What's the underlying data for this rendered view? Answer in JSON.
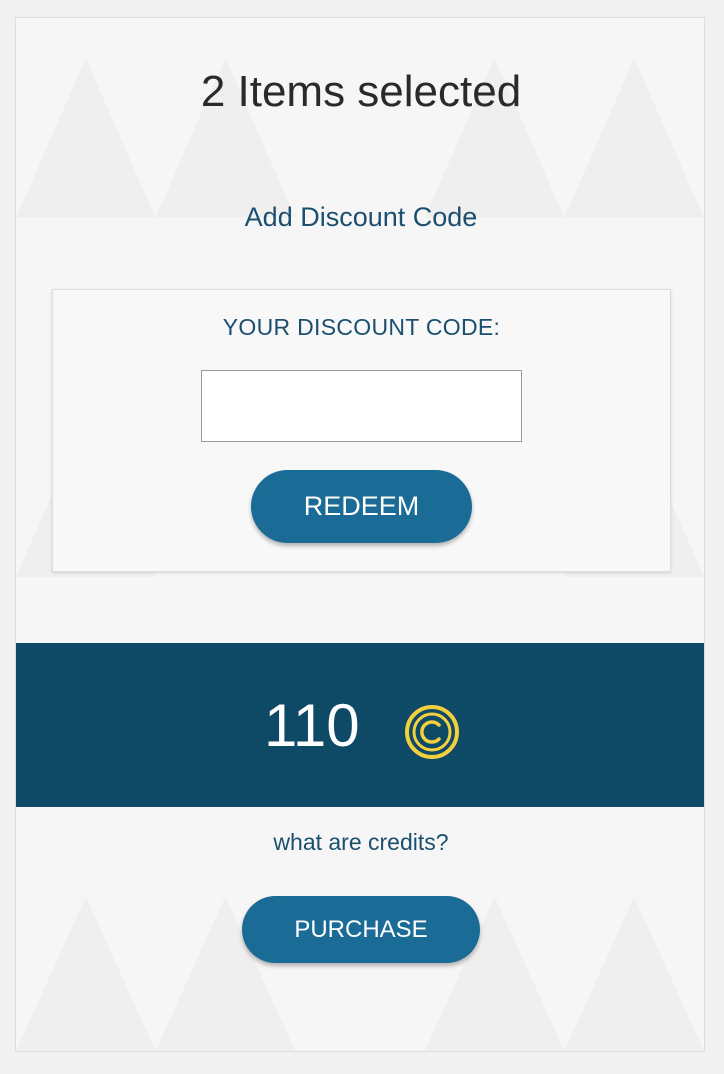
{
  "header": {
    "title": "2 Items selected"
  },
  "discount": {
    "link_label": "Add Discount Code",
    "field_label": "YOUR DISCOUNT CODE:",
    "input_value": "",
    "input_placeholder": "",
    "redeem_label": "REDEEM"
  },
  "credits": {
    "amount": "110",
    "icon": "copyright-coin-icon",
    "help_link": "what are credits?",
    "purchase_label": "PURCHASE"
  },
  "colors": {
    "accent": "#1a6b96",
    "banner": "#0e4a66",
    "coin": "#f4d03f",
    "link": "#1c4f6f"
  }
}
